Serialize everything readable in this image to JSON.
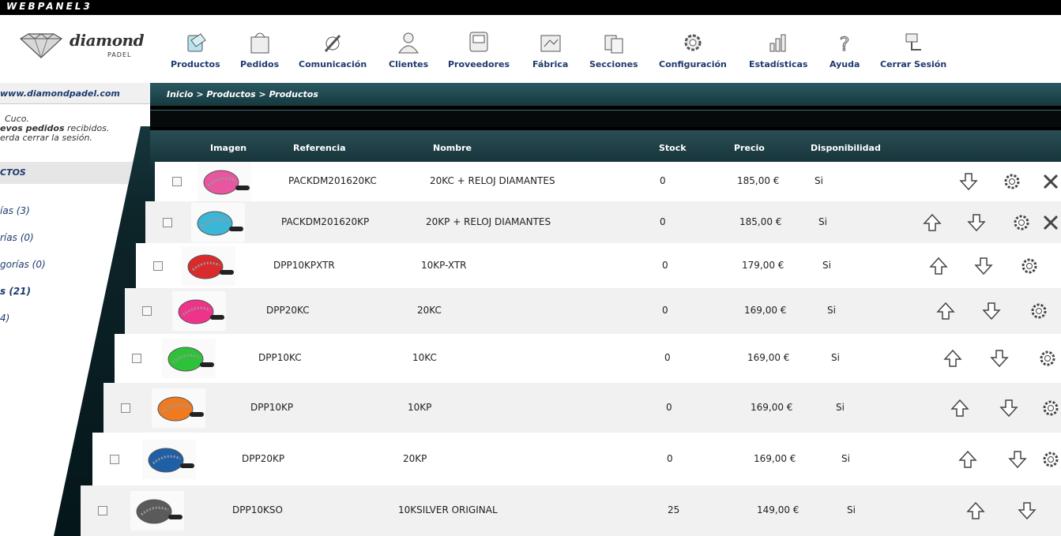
{
  "app": {
    "brand": "WEBPANEL3",
    "logo_name": "diamond",
    "logo_sub": "PADEL"
  },
  "nav": [
    {
      "label": "Productos",
      "icon": "products-icon"
    },
    {
      "label": "Pedidos",
      "icon": "orders-icon"
    },
    {
      "label": "Comunicación",
      "icon": "communication-icon"
    },
    {
      "label": "Clientes",
      "icon": "clients-icon"
    },
    {
      "label": "Proveedores",
      "icon": "suppliers-icon"
    },
    {
      "label": "Fábrica",
      "icon": "factory-icon"
    },
    {
      "label": "Secciones",
      "icon": "sections-icon"
    },
    {
      "label": "Configuración",
      "icon": "gear-icon"
    },
    {
      "label": "Estadísticas",
      "icon": "stats-icon"
    },
    {
      "label": "Ayuda",
      "icon": "help-icon"
    },
    {
      "label": "Cerrar Sesión",
      "icon": "logout-icon"
    }
  ],
  "sidebar": {
    "url": "www.diamondpadel.com",
    "info_line1": "Cuco.",
    "info_line2_bold": "evos pedidos",
    "info_line2_rest": " recibidos.",
    "info_line3": "erda cerrar la sesión.",
    "section_title": "CTOS",
    "links": [
      {
        "label": "ías (3)",
        "active": false
      },
      {
        "label": "rías (0)",
        "active": false
      },
      {
        "label": "gorías (0)",
        "active": false
      },
      {
        "label": "s (21)",
        "active": true
      },
      {
        "label": "4)",
        "active": false
      }
    ]
  },
  "breadcrumb": "Inicio > Productos > Productos",
  "table": {
    "headers": {
      "image": "Imagen",
      "reference": "Referencia",
      "name": "Nombre",
      "stock": "Stock",
      "price": "Precio",
      "availability": "Disponibilidad"
    },
    "rows": [
      {
        "reference": "PACKDM201620KC",
        "name": "20KC + RELOJ DIAMANTES",
        "stock": "0",
        "price": "185,00 €",
        "availability": "Si",
        "color": "#e8569f"
      },
      {
        "reference": "PACKDM201620KP",
        "name": "20KP + RELOJ DIAMANTES",
        "stock": "0",
        "price": "185,00 €",
        "availability": "Si",
        "color": "#3bb6d6"
      },
      {
        "reference": "DPP10KPXTR",
        "name": "10KP-XTR",
        "stock": "0",
        "price": "179,00 €",
        "availability": "Si",
        "color": "#d92b2b"
      },
      {
        "reference": "DPP20KC",
        "name": "20KC",
        "stock": "0",
        "price": "169,00 €",
        "availability": "Si",
        "color": "#f0338a"
      },
      {
        "reference": "DPP10KC",
        "name": "10KC",
        "stock": "0",
        "price": "169,00 €",
        "availability": "Si",
        "color": "#2ec23a"
      },
      {
        "reference": "DPP10KP",
        "name": "10KP",
        "stock": "0",
        "price": "169,00 €",
        "availability": "Si",
        "color": "#f07a20"
      },
      {
        "reference": "DPP20KP",
        "name": "20KP",
        "stock": "0",
        "price": "169,00 €",
        "availability": "Si",
        "color": "#1f5fa6"
      },
      {
        "reference": "DPP10KSO",
        "name": "10KSILVER ORIGINAL",
        "stock": "25",
        "price": "149,00 €",
        "availability": "Si",
        "color": "#5a5a5a"
      }
    ]
  }
}
